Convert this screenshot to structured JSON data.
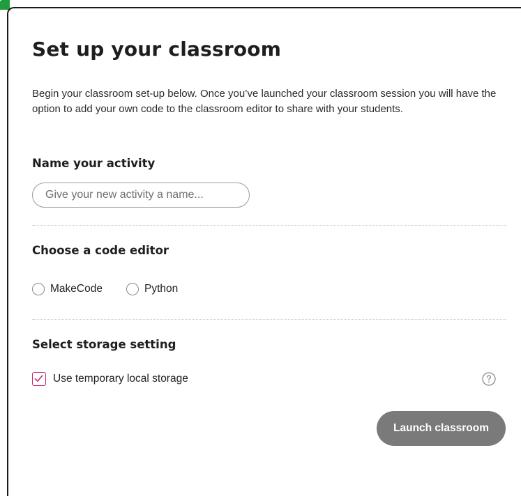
{
  "dialog": {
    "title": "Set up your classroom",
    "intro": "Begin your classroom set-up below. Once you’ve launched your classroom session you will have the option to add your own code to the classroom editor to share with your students."
  },
  "activity": {
    "heading": "Name your activity",
    "placeholder": "Give your new activity a name...",
    "value": ""
  },
  "editor": {
    "heading": "Choose a code editor",
    "options": [
      {
        "label": "MakeCode",
        "selected": false
      },
      {
        "label": "Python",
        "selected": false
      }
    ]
  },
  "storage": {
    "heading": "Select storage setting",
    "checkbox_label": "Use temporary local storage",
    "checked": true,
    "help_icon": "question-circle-icon"
  },
  "actions": {
    "launch_label": "Launch classroom"
  },
  "colors": {
    "accent": "#c8266e",
    "button_disabled": "#7a7a7a",
    "window_corner": "#1f9d3a"
  }
}
